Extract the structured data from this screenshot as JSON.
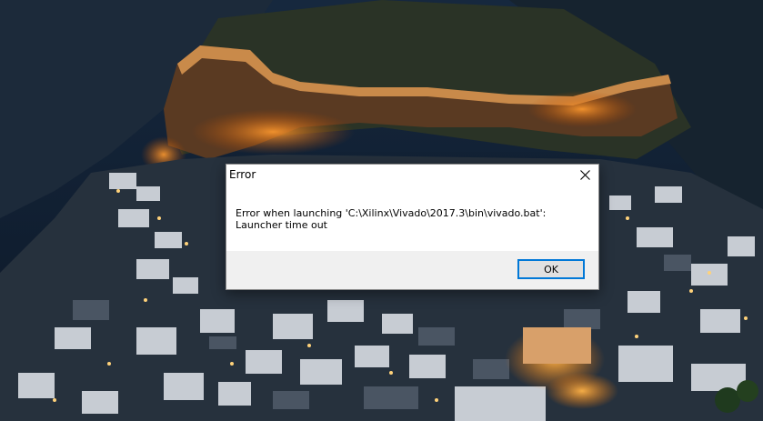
{
  "wallpaper": {
    "description_icon": "village-night-photo"
  },
  "dialog": {
    "title": "Error",
    "message": "Error when launching 'C:\\Xilinx\\Vivado\\2017.3\\bin\\vivado.bat': Launcher time out",
    "ok_label": "OK",
    "close_icon": "close-icon"
  },
  "colors": {
    "accent": "#0078d7",
    "footer_bg": "#f0f0f0",
    "button_bg": "#e1e1e1"
  }
}
